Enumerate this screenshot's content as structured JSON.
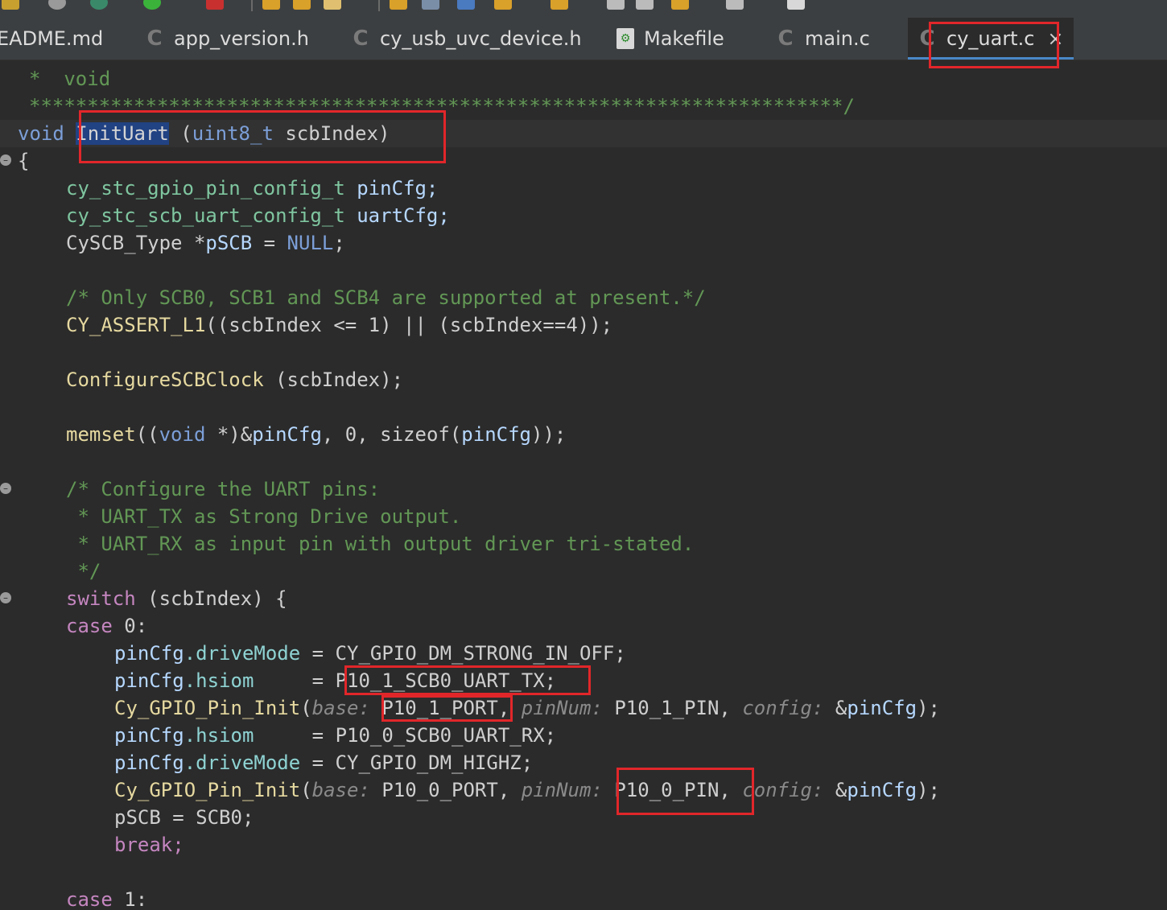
{
  "tabs": [
    {
      "name": "EADME.md",
      "icon": "markdown-file-icon"
    },
    {
      "name": "app_version.h",
      "icon": "c-header-icon"
    },
    {
      "name": "cy_usb_uvc_device.h",
      "icon": "c-header-icon"
    },
    {
      "name": "Makefile",
      "icon": "makefile-icon"
    },
    {
      "name": "main.c",
      "icon": "c-source-icon"
    },
    {
      "name": "cy_uart.c",
      "icon": "c-source-icon",
      "active": true
    }
  ],
  "close_glyph": "×",
  "code": {
    "l1": "*  void",
    "l2": "**********************************************************************/",
    "l3": {
      "kw": "void",
      "fname": "InitUart",
      "rest_a": " (",
      "type": "uint8_t",
      "rest_b": " scbIndex)"
    },
    "l4": "{",
    "l5": {
      "type": "cy_stc_gpio_pin_config_t",
      "var": " pinCfg;"
    },
    "l6": {
      "type": "cy_stc_scb_uart_config_t",
      "var": " uartCfg;"
    },
    "l7": {
      "a": "CySCB_Type *",
      "b": "pSCB",
      "c": " = ",
      "d": "NULL",
      "e": ";"
    },
    "l9": "/* Only SCB0, SCB1 and SCB4 are supported at present.*/",
    "l10": {
      "fn": "CY_ASSERT_L1",
      "rest": "((scbIndex <= 1) || (scbIndex==4));"
    },
    "l12": {
      "fn": "ConfigureSCBClock",
      "rest": " (scbIndex);"
    },
    "l14": {
      "fn": "memset",
      "a": "((",
      "kw": "void",
      "b": " *)&",
      "v1": "pinCfg",
      "c": ", 0, sizeof(",
      "v2": "pinCfg",
      "d": "));"
    },
    "l16": "/* Configure the UART pins:",
    "l17": " * UART_TX as Strong Drive output.",
    "l18": " * UART_RX as input pin with output driver tri-stated.",
    "l19": " */",
    "l20": {
      "kw": "switch",
      "rest": " (scbIndex) {"
    },
    "l21": {
      "kw": "case",
      "rest": " 0:"
    },
    "l22": {
      "obj": "pinCfg",
      "fld": ".driveMode",
      "rest": " = CY_GPIO_DM_STRONG_IN_OFF;"
    },
    "l23": {
      "obj": "pinCfg",
      "fld": ".hsiom",
      "pad": "     = ",
      "rest": "P10_1_SCB0_UART_TX;"
    },
    "l24": {
      "fn": "Cy_GPIO_Pin_Init",
      "p": "(",
      "h1": "base:",
      "a1": " P10_1_PORT",
      "s1": ", ",
      "h2": "pinNum:",
      "a2": " P10_1_PIN",
      "s2": ", ",
      "h3": "config:",
      "a3a": " &",
      "a3b": "pinCfg",
      "e": ");"
    },
    "l25": {
      "obj": "pinCfg",
      "fld": ".hsiom",
      "pad": "     = ",
      "rest": "P10_0_SCB0_UART_RX;"
    },
    "l26": {
      "obj": "pinCfg",
      "fld": ".driveMode",
      "rest": " = CY_GPIO_DM_HIGHZ;"
    },
    "l27": {
      "fn": "Cy_GPIO_Pin_Init",
      "p": "(",
      "h1": "base:",
      "a1": " P10_0_PORT",
      "s1": ", ",
      "h2": "pinNum:",
      "a2": " P10_0_PIN",
      "s2": ", ",
      "h3": "config:",
      "a3a": " &",
      "a3b": "pinCfg",
      "e": ");"
    },
    "l28": "pSCB = SCB0;",
    "l29": "break;",
    "l31": {
      "kw": "case",
      "rest": " 1:"
    }
  }
}
